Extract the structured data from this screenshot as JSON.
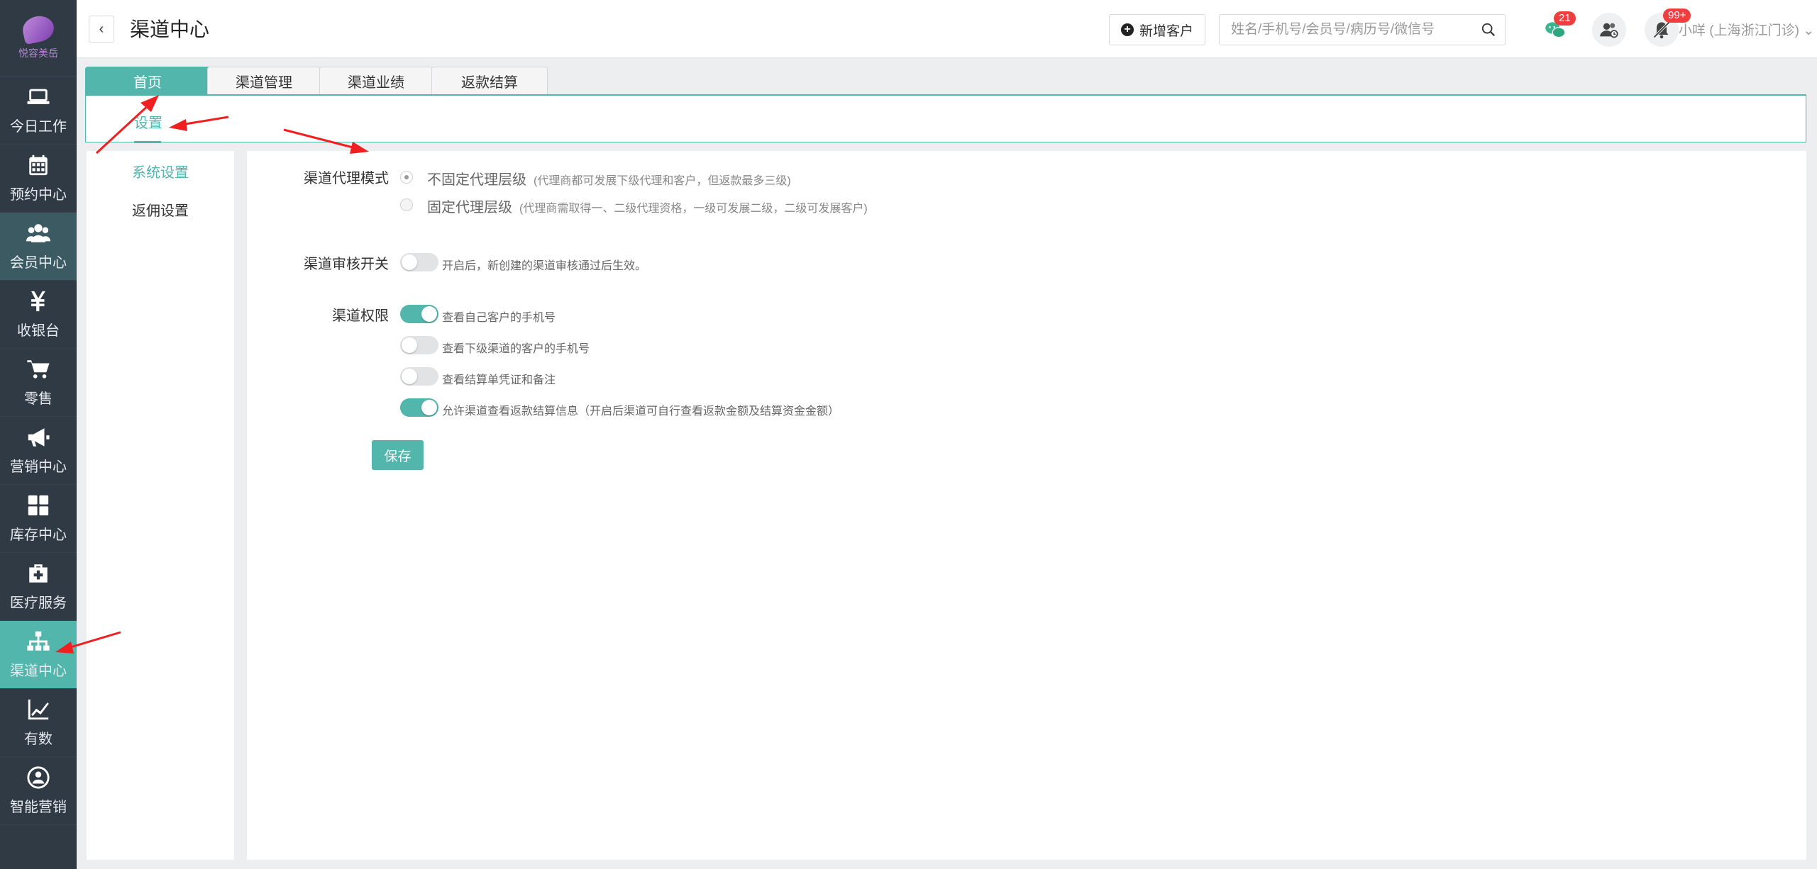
{
  "brand": {
    "logo_text": "悦容美岳"
  },
  "nav": [
    {
      "label": "今日工作",
      "icon": "laptop-icon"
    },
    {
      "label": "预约中心",
      "icon": "calendar-icon"
    },
    {
      "label": "会员中心",
      "icon": "users-icon"
    },
    {
      "label": "收银台",
      "icon": "yen-icon"
    },
    {
      "label": "零售",
      "icon": "cart-icon"
    },
    {
      "label": "营销中心",
      "icon": "megaphone-icon"
    },
    {
      "label": "库存中心",
      "icon": "grid-icon"
    },
    {
      "label": "医疗服务",
      "icon": "medkit-icon"
    },
    {
      "label": "渠道中心",
      "icon": "sitemap-icon",
      "active": true
    },
    {
      "label": "有数",
      "icon": "chart-icon"
    },
    {
      "label": "智能营销",
      "icon": "smart-icon"
    }
  ],
  "header": {
    "title": "渠道中心",
    "add_customer": "新增客户",
    "search_placeholder": "姓名/手机号/会员号/病历号/微信号",
    "wechat_badge": "21",
    "notification_badge": "99+",
    "user": "小咩 (上海浙江门诊)"
  },
  "tabs": [
    "首页",
    "渠道管理",
    "渠道业绩",
    "返款结算"
  ],
  "subtab": "设置",
  "side_menu": [
    "系统设置",
    "返佣设置"
  ],
  "settings": {
    "mode_label": "渠道代理模式",
    "mode_opt1": "不固定代理层级",
    "mode_opt1_note": "(代理商都可发展下级代理和客户，但返款最多三级)",
    "mode_opt2": "固定代理层级",
    "mode_opt2_note": "(代理商需取得一、二级代理资格，一级可发展二级，二级可发展客户)",
    "audit_label": "渠道审核开关",
    "audit_text": "开启后，新创建的渠道审核通过后生效。",
    "perm_label": "渠道权限",
    "perms": [
      {
        "text": "查看自己客户的手机号",
        "on": true
      },
      {
        "text": "查看下级渠道的客户的手机号",
        "on": false
      },
      {
        "text": "查看结算单凭证和备注",
        "on": false
      },
      {
        "text": "允许渠道查看返款结算信息（开启后渠道可自行查看返款金额及结算资金金额）",
        "on": true
      }
    ],
    "save": "保存"
  },
  "colors": {
    "accent": "#52b6ad",
    "sidebar": "#2f3a45",
    "annotation": "#f02020"
  }
}
